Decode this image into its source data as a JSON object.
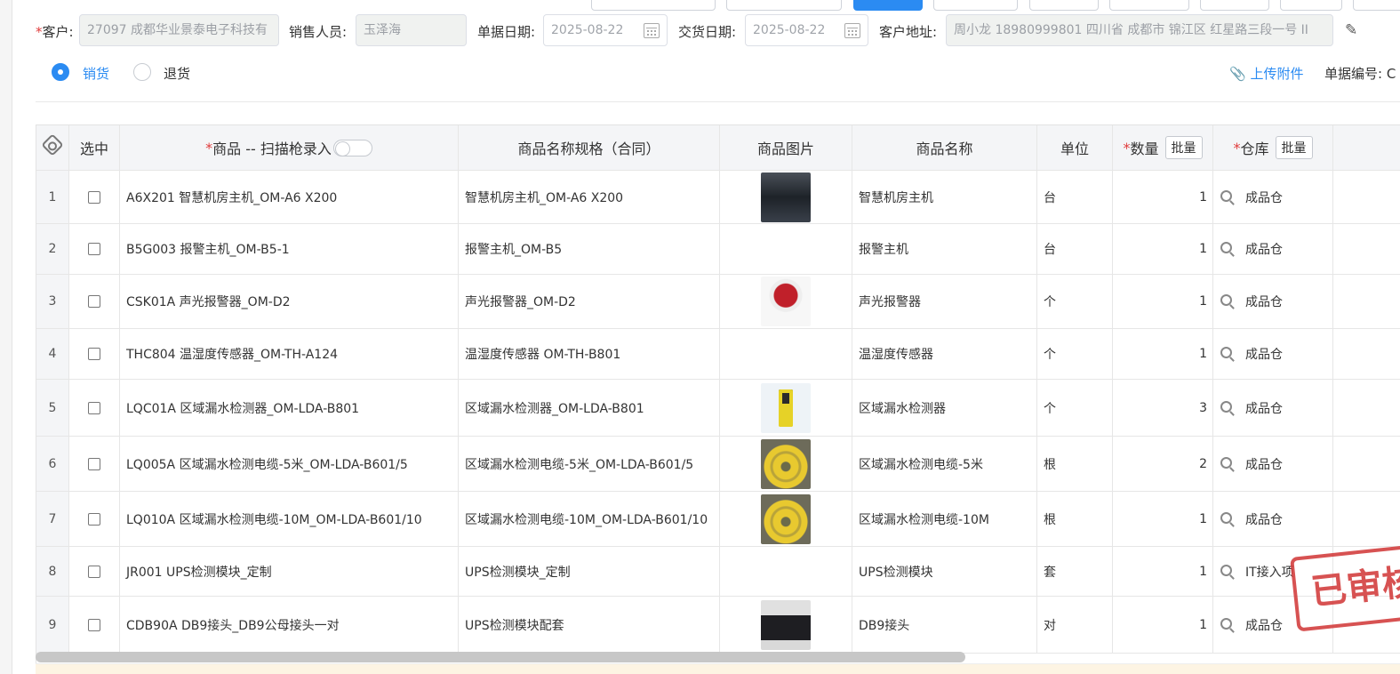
{
  "form": {
    "customer_label": "客户:",
    "customer_value": "27097 成都华业景泰电子科技有",
    "salesperson_label": "销售人员:",
    "salesperson_value": "玉泽海",
    "doc_date_label": "单据日期:",
    "doc_date_value": "2025-08-22",
    "delivery_date_label": "交货日期:",
    "delivery_date_value": "2025-08-22",
    "address_label": "客户地址:",
    "address_value": "周小龙 18980999801 四川省 成都市 锦江区 红星路三段一号 II"
  },
  "mode": {
    "sale_label": "销货",
    "return_label": "退货",
    "selected": "销货"
  },
  "upload_label": "上传附件",
  "doc_no_label": "单据编号: C",
  "table": {
    "headers": {
      "select": "选中",
      "product": "商品 -- 扫描枪录入",
      "spec": "商品名称规格（合同）",
      "image": "商品图片",
      "name": "商品名称",
      "unit": "单位",
      "qty": "数量",
      "warehouse": "仓库",
      "batch": "批量"
    },
    "rows": [
      {
        "idx": "1",
        "product": "A6X201 智慧机房主机_OM-A6 X200",
        "spec": "智慧机房主机_OM-A6 X200",
        "name": "智慧机房主机",
        "unit": "台",
        "qty": "1",
        "warehouse": "成品仓",
        "image": "host-device-image"
      },
      {
        "idx": "2",
        "product": "B5G003 报警主机_OM-B5-1",
        "spec": "报警主机_OM-B5",
        "name": "报警主机",
        "unit": "台",
        "qty": "1",
        "warehouse": "成品仓",
        "image": ""
      },
      {
        "idx": "3",
        "product": "CSK01A 声光报警器_OM-D2",
        "spec": "声光报警器_OM-D2",
        "name": "声光报警器",
        "unit": "个",
        "qty": "1",
        "warehouse": "成品仓",
        "image": "siren-image"
      },
      {
        "idx": "4",
        "product": "THC804 温湿度传感器_OM-TH-A124",
        "spec": "温湿度传感器 OM-TH-B801",
        "name": "温湿度传感器",
        "unit": "个",
        "qty": "1",
        "warehouse": "成品仓",
        "image": ""
      },
      {
        "idx": "5",
        "product": "LQC01A 区域漏水检测器_OM-LDA-B801",
        "spec": "区域漏水检测器_OM-LDA-B801",
        "name": "区域漏水检测器",
        "unit": "个",
        "qty": "3",
        "warehouse": "成品仓",
        "image": "leak-detector-image"
      },
      {
        "idx": "6",
        "product": "LQ005A 区域漏水检测电缆-5米_OM-LDA-B601/5",
        "spec": "区域漏水检测电缆-5米_OM-LDA-B601/5",
        "name": "区域漏水检测电缆-5米",
        "unit": "根",
        "qty": "2",
        "warehouse": "成品仓",
        "image": "cable-image"
      },
      {
        "idx": "7",
        "product": "LQ010A 区域漏水检测电缆-10M_OM-LDA-B601/10",
        "spec": "区域漏水检测电缆-10M_OM-LDA-B601/10",
        "name": "区域漏水检测电缆-10M",
        "unit": "根",
        "qty": "1",
        "warehouse": "成品仓",
        "image": "cable-image"
      },
      {
        "idx": "8",
        "product": "JR001 UPS检测模块_定制",
        "spec": "UPS检测模块_定制",
        "name": "UPS检测模块",
        "unit": "套",
        "qty": "1",
        "warehouse": "IT接入项",
        "image": ""
      },
      {
        "idx": "9",
        "product": "CDB90A DB9接头_DB9公母接头一对",
        "spec": "UPS检测模块配套",
        "name": "DB9接头",
        "unit": "对",
        "qty": "1",
        "warehouse": "成品仓",
        "image": "db9-connector-image"
      }
    ]
  },
  "stamp_text": "已审核",
  "colors": {
    "accent": "#2b8bf2",
    "required": "#e03c3c",
    "stamp": "#d23b3b"
  }
}
